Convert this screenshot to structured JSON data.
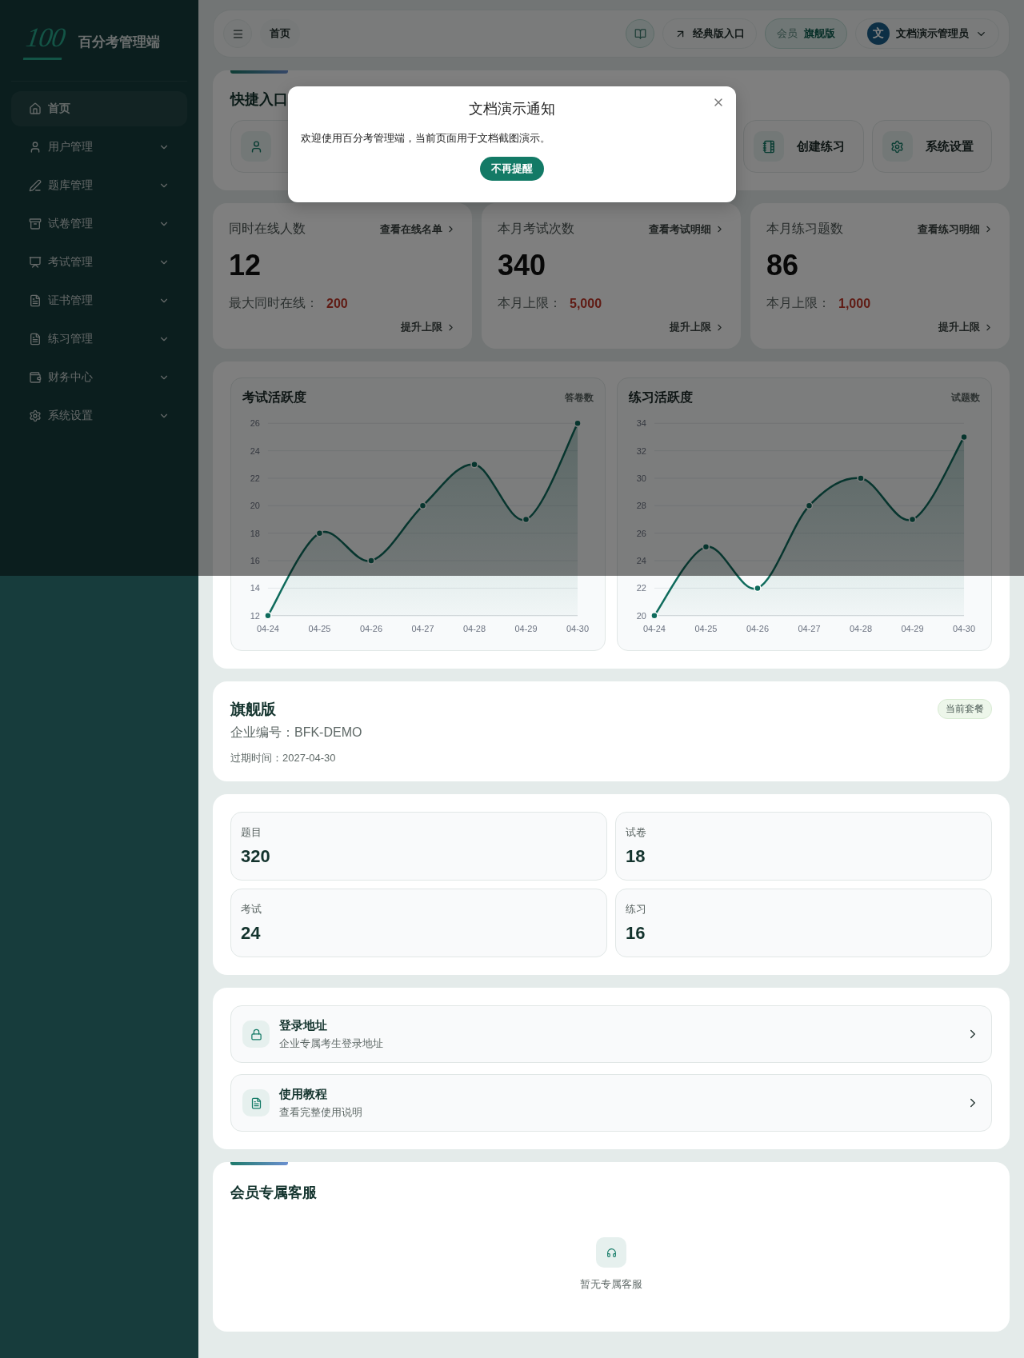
{
  "sidebar": {
    "logo": "100",
    "title": "百分考管理端",
    "items": [
      {
        "label": "首页",
        "kind": "link",
        "selected": true
      },
      {
        "label": "用户管理",
        "kind": "group",
        "selected": false
      },
      {
        "label": "题库管理",
        "kind": "group",
        "selected": false
      },
      {
        "label": "试卷管理",
        "kind": "group",
        "selected": false
      },
      {
        "label": "考试管理",
        "kind": "group",
        "selected": false
      },
      {
        "label": "证书管理",
        "kind": "group",
        "selected": false
      },
      {
        "label": "练习管理",
        "kind": "group",
        "selected": false
      },
      {
        "label": "财务中心",
        "kind": "group",
        "selected": false
      },
      {
        "label": "系统设置",
        "kind": "group",
        "selected": false
      }
    ]
  },
  "topbar": {
    "breadcrumb": "首页",
    "classic_link": "经典版入口",
    "member_label": "会员",
    "member_plan": "旗舰版",
    "avatar": "文",
    "user": "文档演示管理员"
  },
  "quick_entry": {
    "title": "快捷入口",
    "entries": [
      {
        "kind": "user"
      },
      {
        "kind": "notebook",
        "label": "创建练习"
      },
      {
        "kind": "settings",
        "label": "系统设置"
      }
    ]
  },
  "stats": [
    {
      "title": "同时在线人数",
      "link": "查看在线名单",
      "value": "12",
      "limit_label": "最大同时在线：",
      "limit": "200",
      "action": "提升上限"
    },
    {
      "title": "本月考试次数",
      "link": "查看考试明细",
      "value": "340",
      "limit_label": "本月上限：",
      "limit": "5,000",
      "action": "提升上限"
    },
    {
      "title": "本月练习题数",
      "link": "查看练习明细",
      "value": "86",
      "limit_label": "本月上限：",
      "limit": "1,000",
      "action": "提升上限"
    }
  ],
  "charts": [
    {
      "chart_data": {
        "type": "area",
        "title": "考试活跃度",
        "categories": [
          "04-24",
          "04-25",
          "04-26",
          "04-27",
          "04-28",
          "04-29",
          "04-30"
        ],
        "series": [
          {
            "name": "答卷数",
            "color": "#0f6b5c",
            "values": [
              12,
              18,
              16,
              20,
              23,
              19,
              26
            ]
          }
        ],
        "ylim": [
          12,
          26
        ],
        "grid": true,
        "yticks": [
          12,
          14,
          16,
          18,
          20,
          22,
          24,
          26
        ]
      }
    },
    {
      "chart_data": {
        "type": "area",
        "title": "练习活跃度",
        "categories": [
          "04-24",
          "04-25",
          "04-26",
          "04-27",
          "04-28",
          "04-29",
          "04-30"
        ],
        "series": [
          {
            "name": "试题数",
            "color": "#0f6b5c",
            "values": [
              20,
              25,
              22,
              28,
              30,
              27,
              33
            ]
          }
        ],
        "ylim": [
          20,
          34
        ],
        "grid": true,
        "yticks": [
          20,
          22,
          24,
          26,
          28,
          30,
          32,
          34
        ]
      }
    }
  ],
  "plan": {
    "name": "旗舰版",
    "badge": "当前套餐",
    "company": "企业编号：BFK-DEMO",
    "expiry": "过期时间：2027-04-30"
  },
  "counts": [
    {
      "label": "题目",
      "value": "320"
    },
    {
      "label": "试卷",
      "value": "18"
    },
    {
      "label": "考试",
      "value": "24"
    },
    {
      "label": "练习",
      "value": "16"
    }
  ],
  "links": [
    {
      "title": "登录地址",
      "subtitle": "企业专属考生登录地址"
    },
    {
      "title": "使用教程",
      "subtitle": "查看完整使用说明"
    }
  ],
  "service": {
    "title": "会员专属客服",
    "empty": "暂无专属客服"
  },
  "modal": {
    "title": "文档演示通知",
    "message": "欢迎使用百分考管理端，当前页面用于文档截图演示。",
    "button": "不再提醒"
  }
}
